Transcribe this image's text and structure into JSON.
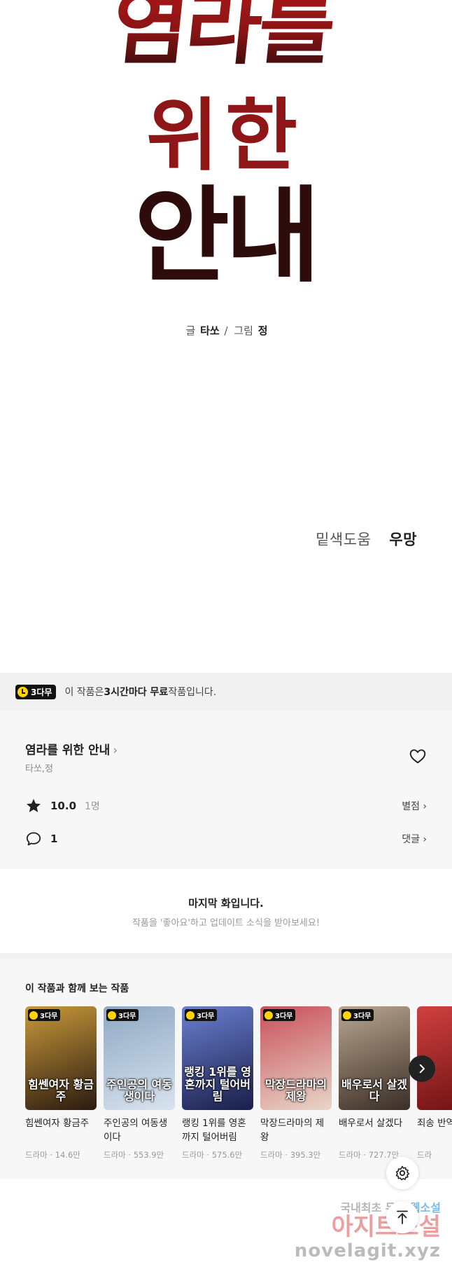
{
  "comic": {
    "title_art": "염라를 위한 안내",
    "credits": {
      "writer_label": "글",
      "writer": "타쏘",
      "sep": "/",
      "artist_label": "그림",
      "artist": "정"
    },
    "sfx": {
      "left": "밑색도움",
      "right": "우망"
    }
  },
  "banner": {
    "badge": "3다무",
    "text_prefix": "이 작품은 ",
    "text_bold": "3시간마다 무료",
    "text_suffix": " 작품입니다."
  },
  "series": {
    "title": "염라를 위한 안내",
    "title_chevron": "›",
    "authors": "타쏘,정",
    "rating": "10.0",
    "rating_count": "1명",
    "rating_link": "별점 ›",
    "comments": "1",
    "comments_link": "댓글 ›"
  },
  "last_episode": {
    "title": "마지막 화입니다.",
    "subtitle": "작품을 '좋아요'하고 업데이트 소식을 받아보세요!"
  },
  "recommendations": {
    "title": "이 작품과 함께 보는 작품",
    "items": [
      {
        "badge": "3다무",
        "cover_title": "힘쎈여자 황금주",
        "name": "힘쎈여자 황금주",
        "meta": "드라마 · 14.6만",
        "color_a": "#2a1a10",
        "color_b": "#c99a3a"
      },
      {
        "badge": "3다무",
        "cover_title": "주인공의 여동생이다",
        "name": "주인공의 여동생이다",
        "meta": "드라마 · 553.9만",
        "color_a": "#d8e3ee",
        "color_b": "#8fa8c4"
      },
      {
        "badge": "3다무",
        "cover_title": "랭킹 1위를 영혼까지 털어버림",
        "name": "랭킹 1위를 영혼까지 털어버림",
        "meta": "드라마 · 575.6만",
        "color_a": "#1a1f4a",
        "color_b": "#6a7fd0"
      },
      {
        "badge": "3다무",
        "cover_title": "막장드라마의 제왕",
        "name": "막장드라마의 제왕",
        "meta": "드라마 · 395.3만",
        "color_a": "#e8d6c8",
        "color_b": "#c8505a"
      },
      {
        "badge": "3다무",
        "cover_title": "배우로서 살겠다",
        "name": "배우로서 살겠다",
        "meta": "드라마 · 727.7만",
        "color_a": "#3a2e26",
        "color_b": "#b8a690"
      },
      {
        "badge": "",
        "cover_title": "",
        "name": "죄송 반역",
        "meta": "드라",
        "color_a": "#6a1010",
        "color_b": "#d04040"
      }
    ]
  },
  "watermark": {
    "line1_a": "국내최초 무료 ",
    "line1_b": "웹소설",
    "line2": "아지트소설",
    "line3": "novelagit.xyz"
  },
  "icons": {
    "heart": "heart-icon",
    "star": "star-icon",
    "comment": "comment-icon",
    "settings": "gear-icon",
    "top": "arrow-up-icon",
    "next": "chevron-right-icon"
  },
  "colors": {
    "accent_yellow": "#ffd400",
    "title_red": "#a81818",
    "title_dark": "#2a0c0c"
  }
}
